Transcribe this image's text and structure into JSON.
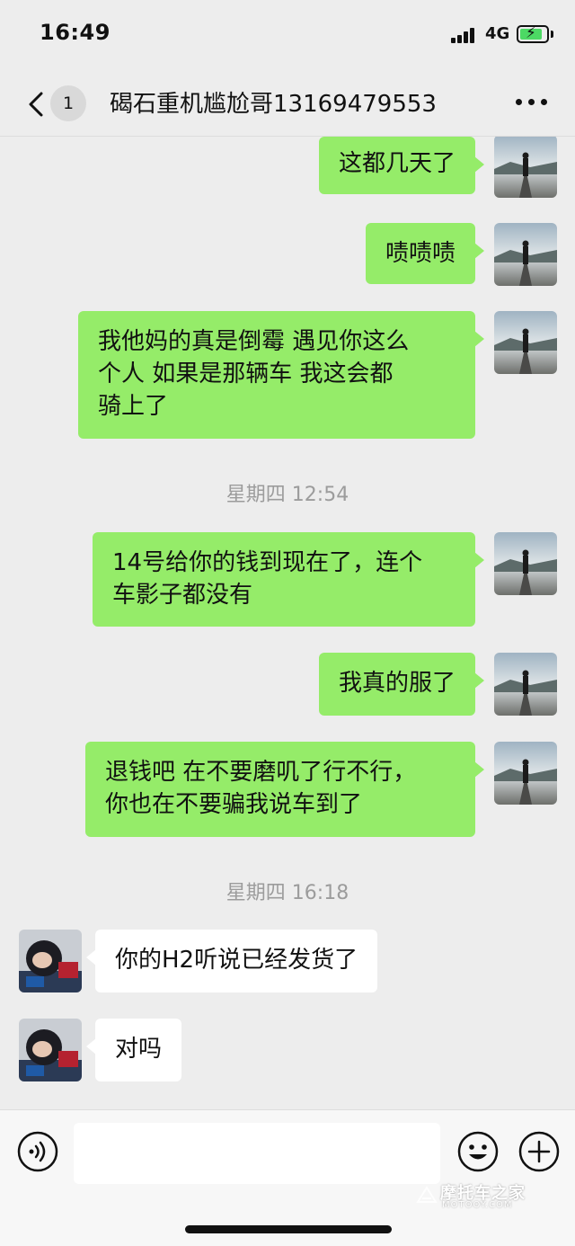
{
  "status_bar": {
    "time": "16:49",
    "network": "4G"
  },
  "nav": {
    "unread_count": "1",
    "title": "碣石重机尴尬哥13169479553"
  },
  "messages": [
    {
      "side": "right",
      "lines": [
        "这都几天了"
      ]
    },
    {
      "side": "right",
      "lines": [
        "啧啧啧"
      ]
    },
    {
      "side": "right",
      "lines": [
        "我他妈的真是倒霉  遇见你这么",
        "个人  如果是那辆车  我这会都",
        "骑上了"
      ]
    },
    {
      "type": "timestamp",
      "text": "星期四 12:54"
    },
    {
      "side": "right",
      "lines": [
        "14号给你的钱到现在了，连个",
        "车影子都没有"
      ]
    },
    {
      "side": "right",
      "lines": [
        "我真的服了"
      ]
    },
    {
      "side": "right",
      "lines": [
        "退钱吧 在不要磨叽了行不行，",
        "你也在不要骗我说车到了"
      ]
    },
    {
      "type": "timestamp",
      "text": "星期四 16:18"
    },
    {
      "side": "left",
      "lines": [
        "你的H2听说已经发货了"
      ]
    },
    {
      "side": "left",
      "lines": [
        "对吗"
      ]
    }
  ],
  "input_bar": {
    "placeholder": ""
  },
  "watermark": {
    "text": "摩托车之家",
    "sub": "MOTOOY.COM"
  },
  "colors": {
    "sent_bubble": "#95ec69",
    "received_bubble": "#ffffff",
    "background": "#ededed"
  }
}
